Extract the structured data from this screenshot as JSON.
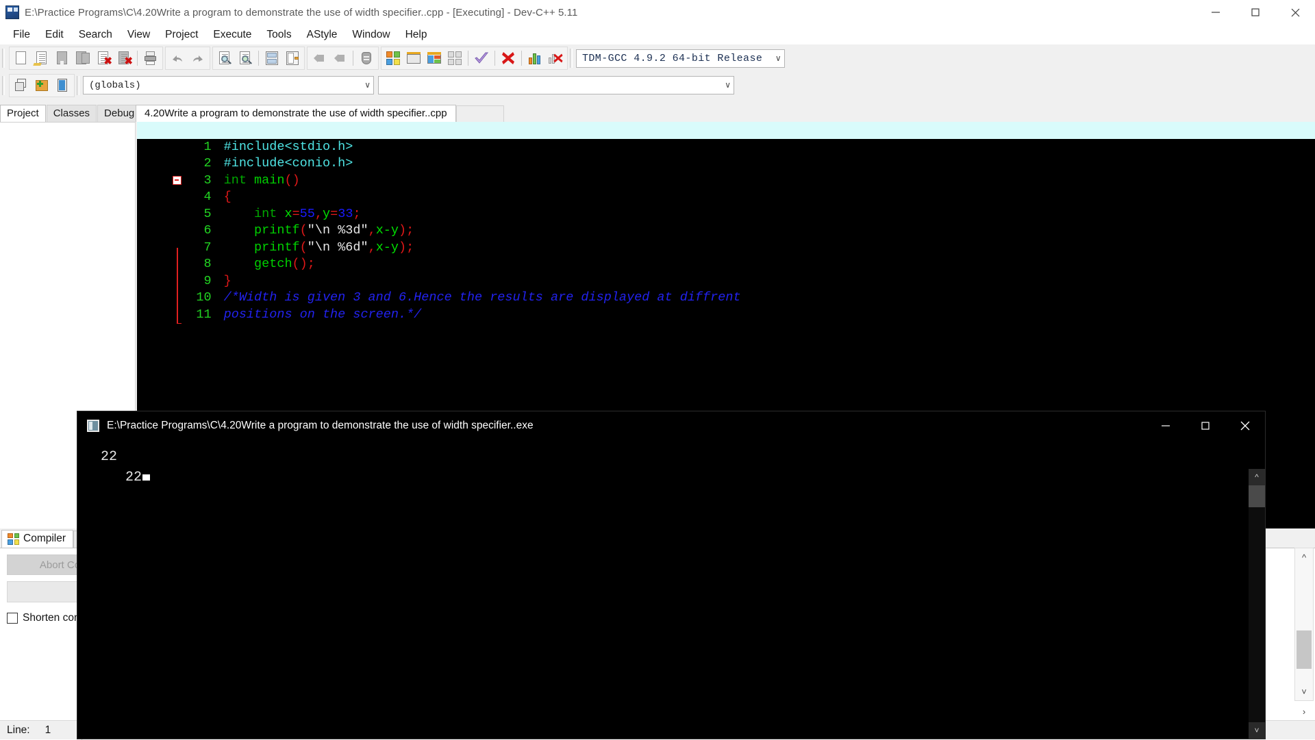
{
  "window": {
    "title": "E:\\Practice Programs\\C\\4.20Write a program to demonstrate the use of width specifier..cpp - [Executing] - Dev-C++ 5.11",
    "minimize": "—",
    "maximize": "❐",
    "close": "✕"
  },
  "menu": {
    "items": [
      {
        "label": "File"
      },
      {
        "label": "Edit"
      },
      {
        "label": "Search"
      },
      {
        "label": "View"
      },
      {
        "label": "Project"
      },
      {
        "label": "Execute"
      },
      {
        "label": "Tools"
      },
      {
        "label": "AStyle"
      },
      {
        "label": "Window"
      },
      {
        "label": "Help"
      }
    ]
  },
  "toolbar": {
    "compiler_select": "TDM-GCC 4.9.2 64-bit Release",
    "scope_select": "(globals)",
    "member_select": "",
    "caret": "∨"
  },
  "left_panel": {
    "tabs": [
      {
        "label": "Project",
        "active": true
      },
      {
        "label": "Classes",
        "active": false
      },
      {
        "label": "Debug",
        "active": false
      }
    ]
  },
  "editor": {
    "tab_label": "4.20Write a program to demonstrate the use of width specifier..cpp",
    "lines": [
      {
        "num": "1",
        "highlight": true
      },
      {
        "num": "2",
        "highlight": false
      },
      {
        "num": "3",
        "highlight": false
      },
      {
        "num": "4",
        "highlight": false
      },
      {
        "num": "5",
        "highlight": false
      },
      {
        "num": "6",
        "highlight": false
      },
      {
        "num": "7",
        "highlight": false
      },
      {
        "num": "8",
        "highlight": false
      },
      {
        "num": "9",
        "highlight": false
      },
      {
        "num": "10",
        "highlight": false
      },
      {
        "num": "11",
        "highlight": false
      }
    ],
    "code": {
      "l1_pre": "#include<stdio.h>",
      "l2_pre": "#include<conio.h>",
      "l3_key": "int ",
      "l3_fn": "main",
      "l3_punct": "()",
      "l4_brace": "{",
      "l5_key": "    int ",
      "l5_x": "x",
      "l5_eq1": "=",
      "l5_v1": "55",
      "l5_comma": ",",
      "l5_y": "y",
      "l5_eq2": "=",
      "l5_v2": "33",
      "l5_semi": ";",
      "l6_fn": "    printf",
      "l6_open": "(",
      "l6_str": "\"\\n %3d\"",
      "l6_comma": ",",
      "l6_expr": "x-y",
      "l6_close": ");",
      "l7_fn": "    printf",
      "l7_open": "(",
      "l7_str": "\"\\n %6d\"",
      "l7_comma": ",",
      "l7_expr": "x-y",
      "l7_close": ");",
      "l8_fn": "    getch",
      "l8_close": "();",
      "l9_brace": "}",
      "l10_cmt": "/*Width is given 3 and 6.Hence the results are displayed at diffrent",
      "l11_cmt": "positions on the screen.*/"
    }
  },
  "bottom_panel": {
    "tabs": [
      {
        "label": "Compiler",
        "active": true
      },
      {
        "label": "",
        "active": false
      }
    ],
    "abort_button": "Abort Compilation",
    "shorten_checkbox": "Shorten compiler paths"
  },
  "status_bar": {
    "line_label": "Line:",
    "line_value": "1"
  },
  "console": {
    "title": "E:\\Practice Programs\\C\\4.20Write a program to demonstrate the use of width specifier..exe",
    "minimize": "—",
    "maximize": "☐",
    "close": "✕",
    "output_line1": " 22",
    "output_line2": "    22"
  },
  "colors": {
    "accent_blue": "#2a5fa8",
    "editor_bg": "#000000",
    "highlight_line": "#d9fbfb",
    "gutter_green": "#22d422",
    "comment_blue": "#2222ee",
    "string_white": "#e8e8e8",
    "number_blue": "#1a1aff",
    "punct_red": "#e01818",
    "preproc_cyan": "#4fe5e5"
  }
}
